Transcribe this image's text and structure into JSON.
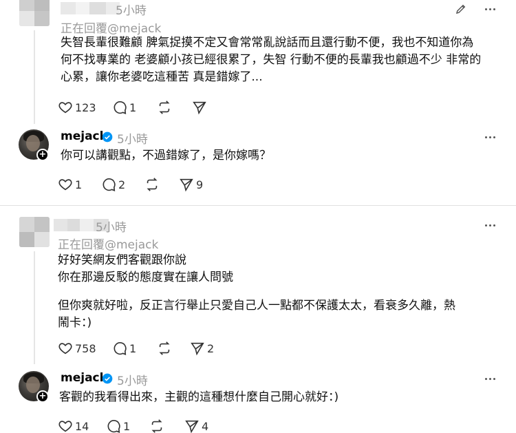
{
  "posts": [
    {
      "time": "5小時",
      "replying": "正在回覆@mejack",
      "text_lines": [
        "失智長輩很難顧 脾氣捉摸不定又會常常亂說話而且還行動不便，我也不知道你為",
        "何不找專業的 老婆顧小孩已經很累了，失智 行動不便的長輩我也顧過不少 非常的",
        "心累，讓你老婆吃這種苦 真是錯嫁了..."
      ],
      "likes": "123",
      "replies": "1",
      "reposts": "",
      "shares": ""
    },
    {
      "username": "mejack",
      "time": "5小時",
      "text_lines": [
        "你可以講觀點，不過錯嫁了，是你嫁嗎？"
      ],
      "likes": "1",
      "replies": "2",
      "reposts": "",
      "shares": "9"
    },
    {
      "time": "5小時",
      "replying": "正在回覆@mejack",
      "text_lines": [
        "好好笑網友們客觀跟你說",
        "你在那邊反駁的態度實在讓人問號",
        "",
        "但你爽就好啦，反正言行舉止只愛自己人一點都不保護太太，看衰多久離，熱",
        "鬧卡：)"
      ],
      "likes": "758",
      "replies": "1",
      "reposts": "",
      "shares": "2"
    },
    {
      "username": "mejack",
      "time": "5小時",
      "text_lines": [
        "客觀的我看得出來，主觀的這種想什麼自己開心就好：)"
      ],
      "likes": "14",
      "replies": "1",
      "reposts": "",
      "shares": "4"
    }
  ],
  "colors": {
    "text": "#101010",
    "muted": "#999999",
    "verified": "#0095f6",
    "divider": "#e0e0e0"
  },
  "icons": [
    "heart-icon",
    "comment-icon",
    "repost-icon",
    "share-icon",
    "more-icon",
    "edit-icon",
    "verified-icon",
    "plus-icon"
  ]
}
